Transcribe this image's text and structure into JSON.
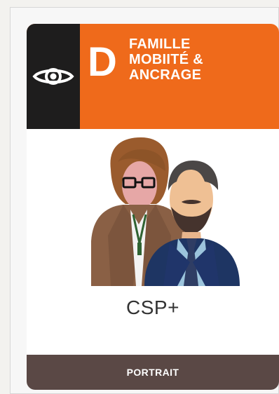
{
  "card": {
    "letter": "D",
    "title": "FAMILLE\nMOBIITÉ &\nANCRAGE",
    "label": "CSP+",
    "footer_label": "PORTRAIT",
    "icon": "eye-icon",
    "illustration": "people-illustration"
  },
  "colors": {
    "header_orange": "#ef6a1b",
    "eye_panel_black": "#1e1d1d",
    "footer_brown": "#5a4845"
  }
}
